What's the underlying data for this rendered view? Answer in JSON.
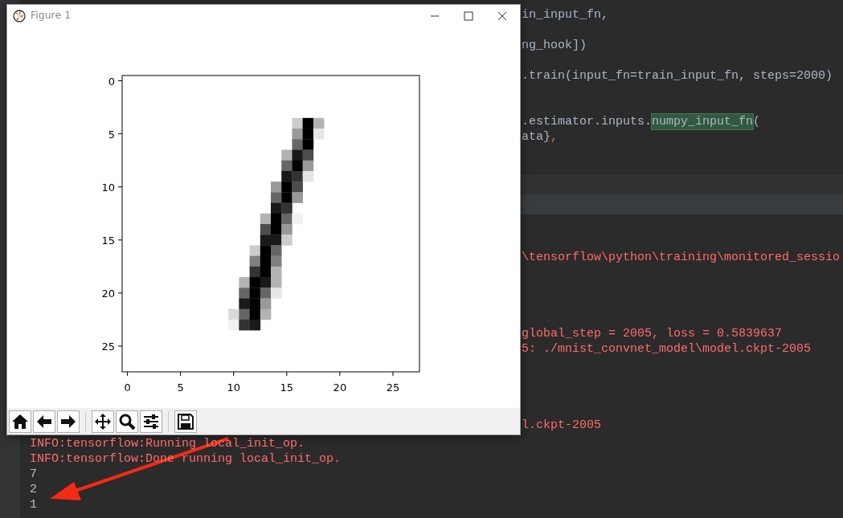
{
  "editor": {
    "lines": [
      {
        "segments": [
          {
            "text": "in_input_fn,",
            "kind": "code"
          }
        ]
      },
      {
        "segments": [
          {
            "text": "ng_hook])",
            "kind": "code"
          }
        ]
      },
      {
        "segments": [
          {
            "text": ".train(input_fn=train_input_fn, steps=2000)",
            "kind": "code"
          }
        ]
      },
      {
        "segments": [
          {
            "text": ".estimator.inputs.",
            "kind": "code"
          },
          {
            "text": "numpy_input_fn",
            "kind": "match"
          },
          {
            "text": "(",
            "kind": "code"
          }
        ]
      },
      {
        "segments": [
          {
            "text": "ata}",
            "kind": "code"
          },
          {
            "text": ",",
            "kind": "punct"
          }
        ]
      }
    ]
  },
  "console": {
    "lines": [
      {
        "text": "\\tensorflow\\python\\training\\monitored_sessio",
        "kind": "log"
      },
      {
        "text": "global_step = 2005, loss = 0.5839637",
        "kind": "log"
      },
      {
        "text": "5: ./mnist_convnet_model\\model.ckpt-2005",
        "kind": "log"
      },
      {
        "text": "l.ckpt-2005",
        "kind": "log"
      },
      {
        "text": "INFO:tensorflow:Running local_init_op.",
        "kind": "log"
      },
      {
        "text": "INFO:tensorflow:Done running local_init_op.",
        "kind": "log"
      },
      {
        "text": "7",
        "kind": "output"
      },
      {
        "text": "2",
        "kind": "output"
      },
      {
        "text": "1",
        "kind": "output"
      }
    ]
  },
  "figure": {
    "title": "Figure 1",
    "plot": {
      "xticks": [
        "0",
        "5",
        "10",
        "15",
        "20",
        "25"
      ],
      "yticks": [
        "0",
        "5",
        "10",
        "15",
        "20",
        "25"
      ]
    }
  }
}
